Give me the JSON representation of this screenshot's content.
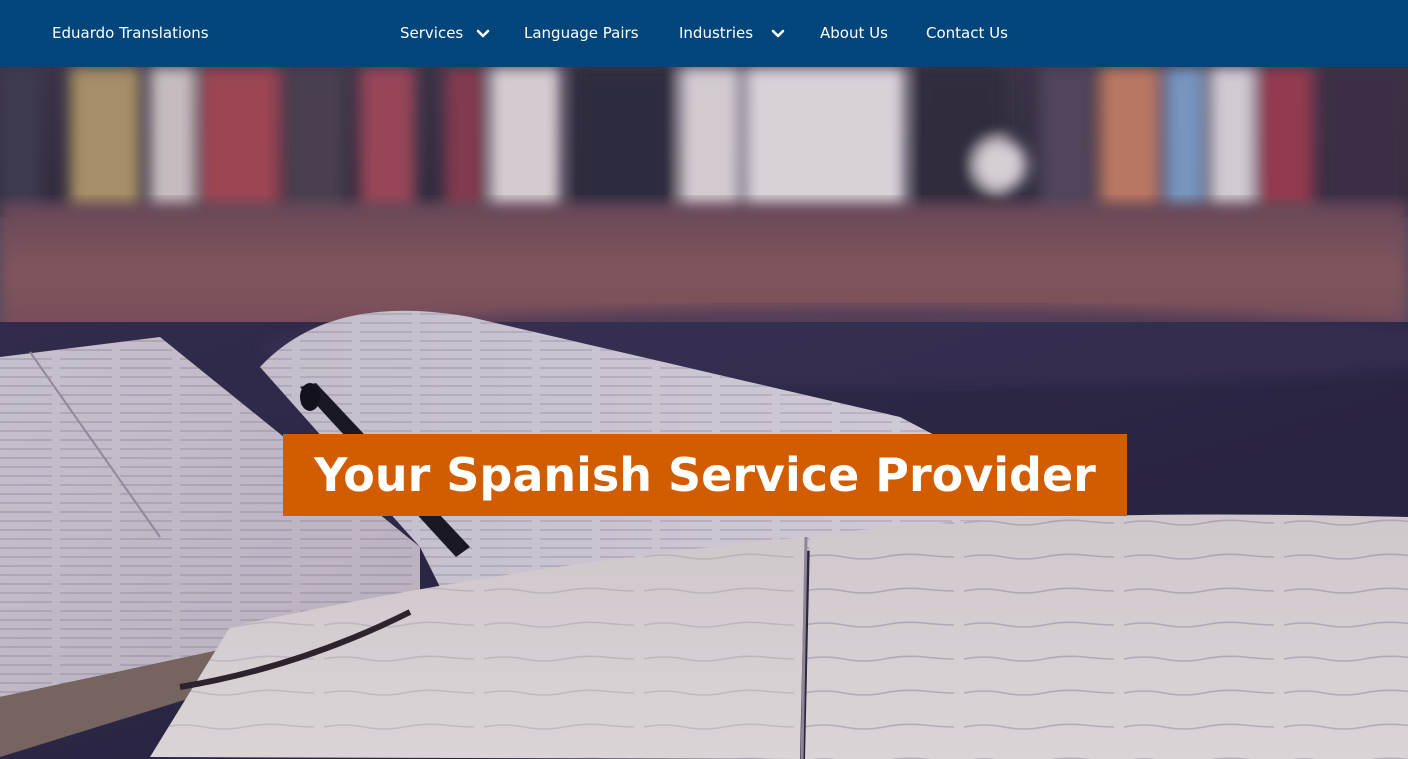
{
  "nav": {
    "brand": "Eduardo Translations",
    "items": [
      {
        "label": "Services",
        "has_dropdown": true
      },
      {
        "label": "Language Pairs",
        "has_dropdown": false
      },
      {
        "label": "Industries",
        "has_dropdown": true
      },
      {
        "label": "About Us",
        "has_dropdown": false
      },
      {
        "label": "Contact Us",
        "has_dropdown": false
      }
    ],
    "dropdown_icon": "chevron-down-icon"
  },
  "hero": {
    "headline": "Your Spanish Service Provider",
    "image": "books-and-open-notebook-photo"
  },
  "colors": {
    "nav_background": "#02457a",
    "nav_text": "#ffffff",
    "headline_background": "#d25d00",
    "headline_text": "#ffffff"
  }
}
